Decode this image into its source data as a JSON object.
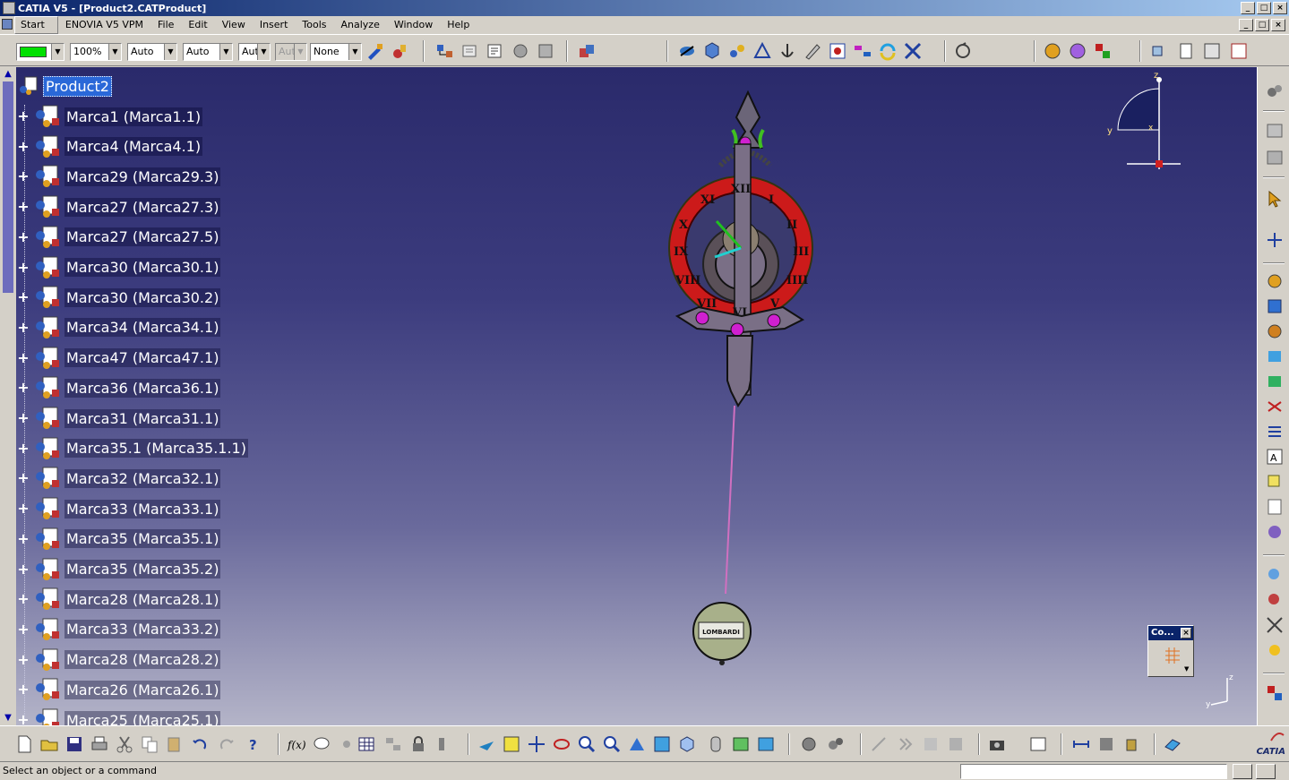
{
  "window": {
    "title": "CATIA V5 - [Product2.CATProduct]",
    "controls": [
      "_",
      "□",
      "×"
    ]
  },
  "menu": {
    "items": [
      "Start",
      "ENOVIA V5 VPM",
      "File",
      "Edit",
      "View",
      "Insert",
      "Tools",
      "Analyze",
      "Window",
      "Help"
    ]
  },
  "toolbar": {
    "zoom_value": "100%",
    "line_type": "Auto",
    "line_weight": "Auto",
    "layer_short": "Aut",
    "disabled_short": "Aut",
    "layer": "None",
    "color_swatch": "#00e000"
  },
  "tree": {
    "root": "Product2",
    "children": [
      "Marca1 (Marca1.1)",
      "Marca4 (Marca4.1)",
      "Marca29 (Marca29.3)",
      "Marca27 (Marca27.3)",
      "Marca27 (Marca27.5)",
      "Marca30 (Marca30.1)",
      "Marca30 (Marca30.2)",
      "Marca34 (Marca34.1)",
      "Marca47 (Marca47.1)",
      "Marca36 (Marca36.1)",
      "Marca31 (Marca31.1)",
      "Marca35.1 (Marca35.1.1)",
      "Marca32 (Marca32.1)",
      "Marca33 (Marca33.1)",
      "Marca35 (Marca35.1)",
      "Marca35 (Marca35.2)",
      "Marca28 (Marca28.1)",
      "Marca33 (Marca33.2)",
      "Marca28 (Marca28.2)",
      "Marca26 (Marca26.1)",
      "Marca25 (Marca25.1)"
    ]
  },
  "compass": {
    "z": "z",
    "y": "y",
    "x": "x"
  },
  "mini_axis": {
    "z": "z",
    "y": "y"
  },
  "dialog": {
    "title": "Co...",
    "close": "×"
  },
  "clock": {
    "numerals": [
      "XII",
      "I",
      "II",
      "III",
      "IIII",
      "V",
      "VI",
      "VII",
      "VIII",
      "IX",
      "X",
      "XI"
    ],
    "weight_label": "LOMBARDI",
    "colors": {
      "ring": "#cc1a1a",
      "frame": "#7a6f86",
      "pins": "#d020d0",
      "weight": "#a8b08a"
    }
  },
  "status": {
    "message": "Select an object or a command"
  },
  "brand": "CATIA"
}
